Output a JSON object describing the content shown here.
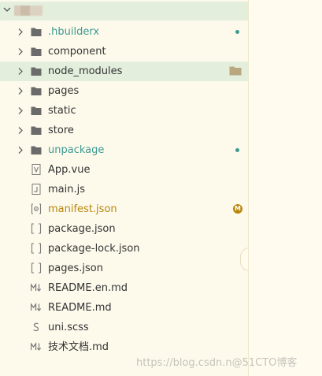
{
  "project": {
    "name": ""
  },
  "tree": {
    "items": [
      {
        "label": ".hbuilderx",
        "type": "folder",
        "style": "teal",
        "marker": "dot"
      },
      {
        "label": "component",
        "type": "folder",
        "style": "normal"
      },
      {
        "label": "node_modules",
        "type": "folder",
        "style": "normal",
        "selected": true
      },
      {
        "label": "pages",
        "type": "folder",
        "style": "normal"
      },
      {
        "label": "static",
        "type": "folder",
        "style": "normal"
      },
      {
        "label": "store",
        "type": "folder",
        "style": "normal"
      },
      {
        "label": "unpackage",
        "type": "folder",
        "style": "teal",
        "marker": "dot"
      },
      {
        "label": "App.vue",
        "type": "file",
        "icon": "vue-file-icon",
        "style": "normal"
      },
      {
        "label": "main.js",
        "type": "file",
        "icon": "js-file-icon",
        "style": "normal"
      },
      {
        "label": "manifest.json",
        "type": "file",
        "icon": "manifest-file-icon",
        "style": "gold",
        "marker": "M"
      },
      {
        "label": "package.json",
        "type": "file",
        "icon": "json-file-icon",
        "style": "normal"
      },
      {
        "label": "package-lock.json",
        "type": "file",
        "icon": "json-file-icon",
        "style": "normal"
      },
      {
        "label": "pages.json",
        "type": "file",
        "icon": "json-file-icon",
        "style": "normal"
      },
      {
        "label": "README.en.md",
        "type": "file",
        "icon": "markdown-file-icon",
        "style": "normal"
      },
      {
        "label": "README.md",
        "type": "file",
        "icon": "markdown-file-icon",
        "style": "normal"
      },
      {
        "label": "uni.scss",
        "type": "file",
        "icon": "scss-file-icon",
        "style": "normal"
      },
      {
        "label": "技术文档.md",
        "type": "file",
        "icon": "markdown-file-icon",
        "style": "normal"
      }
    ]
  },
  "watermark": "https://blog.csdn.n@51CTO博客",
  "colors": {
    "background": "#fdfaec",
    "selected_row": "#e3eedd",
    "teal": "#3c9a90",
    "gold": "#b8860b",
    "text": "#333333",
    "folder_icon": "#6b6b6b"
  }
}
